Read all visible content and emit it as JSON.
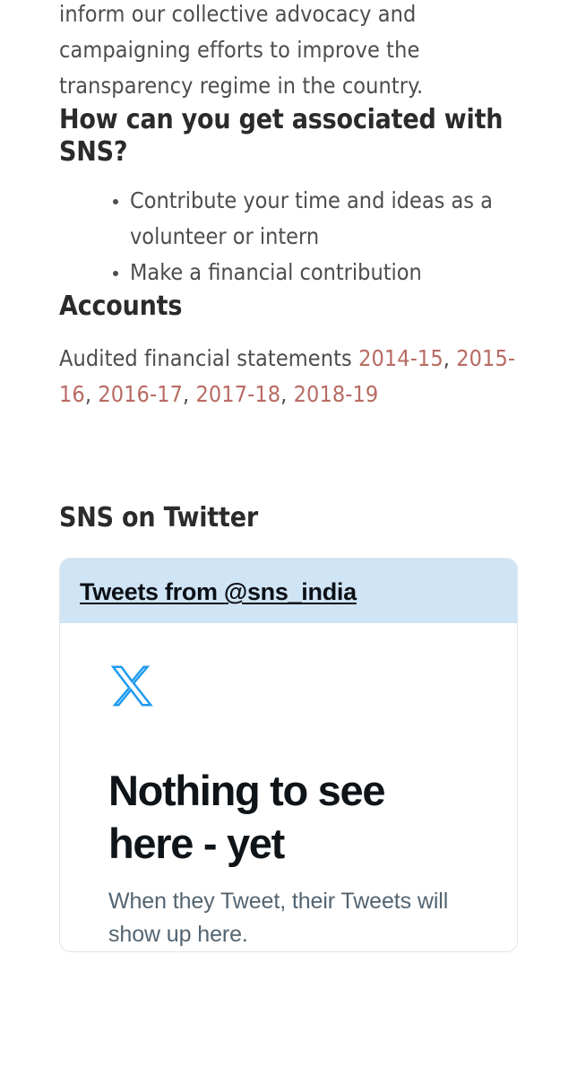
{
  "article": {
    "intro_paragraph": "inform our collective advocacy and campaigning efforts to improve the transparency regime in the country.",
    "associate_heading": "How can you get associated with SNS?",
    "associate_bullets": [
      "Contribute your time and ideas as a volunteer or intern",
      "Make a financial contribution"
    ],
    "accounts_heading": "Accounts",
    "accounts_intro": "Audited financial statements ",
    "accounts_links": [
      {
        "label": "2014-15",
        "sep": ", "
      },
      {
        "label": "2015-16",
        "sep": ", "
      },
      {
        "label": "2016-17",
        "sep": ", "
      },
      {
        "label": "2017-18",
        "sep": ", "
      },
      {
        "label": "2018-19",
        "sep": ""
      }
    ],
    "link_color": "#b86b63"
  },
  "twitter_section": {
    "heading": "SNS on Twitter",
    "widget": {
      "header_link_label": "Tweets from @sns_india",
      "header_background": "#cfe4f5",
      "logo_icon": "x-twitter-icon",
      "logo_color": "#1d9bf0",
      "empty_title": "Nothing to see here - yet",
      "empty_subtitle": "When they Tweet, their Tweets will show up here."
    }
  }
}
